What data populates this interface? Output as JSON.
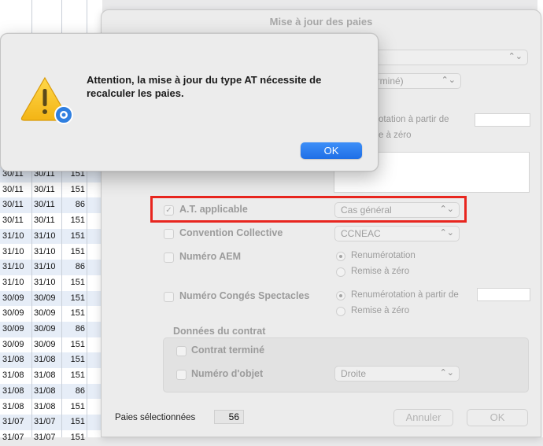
{
  "background_table": {
    "rows": [
      {
        "d1": "30/11",
        "d2": "30/11",
        "n": "151"
      },
      {
        "d1": "30/11",
        "d2": "30/11",
        "n": "151"
      },
      {
        "d1": "30/11",
        "d2": "30/11",
        "n": "86"
      },
      {
        "d1": "30/11",
        "d2": "30/11",
        "n": "151"
      },
      {
        "d1": "31/10",
        "d2": "31/10",
        "n": "151"
      },
      {
        "d1": "31/10",
        "d2": "31/10",
        "n": "151"
      },
      {
        "d1": "31/10",
        "d2": "31/10",
        "n": "86"
      },
      {
        "d1": "31/10",
        "d2": "31/10",
        "n": "151"
      },
      {
        "d1": "30/09",
        "d2": "30/09",
        "n": "151"
      },
      {
        "d1": "30/09",
        "d2": "30/09",
        "n": "151"
      },
      {
        "d1": "30/09",
        "d2": "30/09",
        "n": "86"
      },
      {
        "d1": "30/09",
        "d2": "30/09",
        "n": "151"
      },
      {
        "d1": "31/08",
        "d2": "31/08",
        "n": "151"
      },
      {
        "d1": "31/08",
        "d2": "31/08",
        "n": "151"
      },
      {
        "d1": "31/08",
        "d2": "31/08",
        "n": "86"
      },
      {
        "d1": "31/08",
        "d2": "31/08",
        "n": "151"
      },
      {
        "d1": "31/07",
        "d2": "31/07",
        "n": "151"
      },
      {
        "d1": "31/07",
        "d2": "31/07",
        "n": "151"
      }
    ]
  },
  "sheet": {
    "title": "Mise à jour des paies",
    "partial_popup_text": "erminé)",
    "partial_renum_text": "otation à partir de",
    "partial_reset_text": "e à zéro",
    "at_applicable": {
      "label": "A.T. applicable",
      "checked": true,
      "value": "Cas général"
    },
    "convention": {
      "label": "Convention Collective",
      "checked": false,
      "value": "CCNEAC"
    },
    "aem": {
      "label": "Numéro AEM",
      "checked": false,
      "radio1": "Renumérotation",
      "radio2": "Remise à zéro"
    },
    "conges": {
      "label": "Numéro Congés Spectacles",
      "checked": false,
      "radio1": "Renumérotation à partir de",
      "radio2": "Remise à zéro"
    },
    "contract_group": {
      "title": "Données du contrat",
      "contrat_termine": "Contrat terminé",
      "numero_objet": "Numéro d'objet",
      "numero_objet_value": "Droite"
    },
    "footer": {
      "selected_label": "Paies sélectionnées",
      "selected_count": "56",
      "cancel": "Annuler",
      "ok": "OK"
    }
  },
  "alert": {
    "message": "Attention, la mise à jour du type AT nécessite de recalculer les paies.",
    "ok": "OK"
  },
  "colors": {
    "highlight_red": "#e8261f",
    "accent_blue": "#1f6fe6"
  }
}
